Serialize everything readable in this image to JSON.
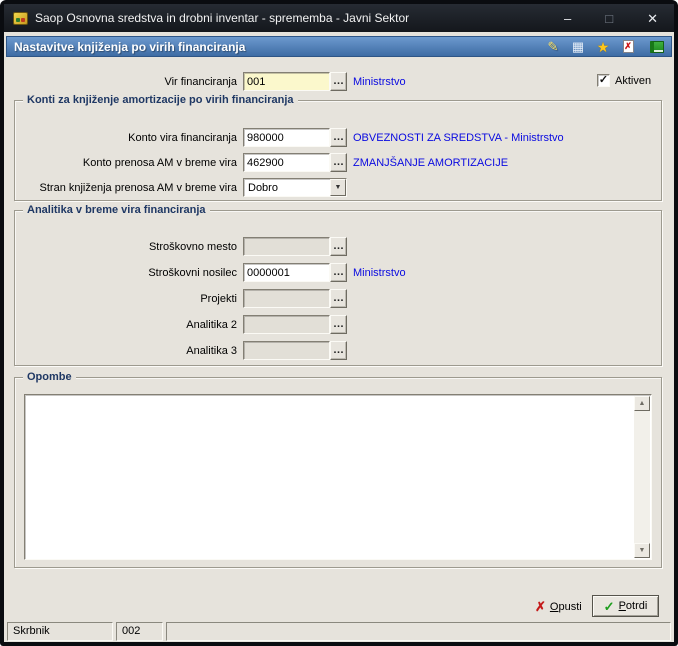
{
  "colors": {
    "window_bg": "#E6E3DC",
    "titlebar_top": "#262B33",
    "titlebar_bottom": "#14171C",
    "header_top": "#6C99CE",
    "header_bottom": "#3E6CA4",
    "accent_blue": "#0A0AE0",
    "field_yellow": "#FBF8CC",
    "group_title": "#1F3864",
    "cancel_red": "#C41A1A",
    "confirm_green": "#1E9E1E"
  },
  "window": {
    "title": "Saop Osnovna sredstva in drobni inventar - sprememba - Javni Sektor"
  },
  "header": {
    "title": "Nastavitve knjiženja po virih financiranja"
  },
  "icons": {
    "minimize": "–",
    "maximize": "□",
    "close": "✕",
    "pencil": "✎",
    "grid": "▦",
    "star": "★",
    "cross": "✗",
    "check": "✓",
    "ellipsis": "…",
    "dropdown_arrow": "▼",
    "scroll_up": "▲",
    "scroll_down": "▼",
    "checkbox_check": "✓"
  },
  "form": {
    "vir": {
      "label": "Vir financiranja",
      "value": "001",
      "desc": "Ministrstvo"
    },
    "aktiven": {
      "label": "Aktiven",
      "checked": true
    }
  },
  "konti": {
    "title": "Konti za knjiženje amortizacije po virih financiranja",
    "konto_vira": {
      "label": "Konto vira financiranja",
      "value": "980000",
      "desc": "OBVEZNOSTI ZA SREDSTVA - Ministrstvo"
    },
    "konto_prenosa": {
      "label": "Konto prenosa AM v breme vira",
      "value": "462900",
      "desc": "ZMANJŠANJE AMORTIZACIJE"
    },
    "stran": {
      "label": "Stran knjiženja prenosa AM v breme vira",
      "value": "Dobro"
    }
  },
  "analitika": {
    "title": "Analitika v breme vira financiranja",
    "rows": [
      {
        "label": "Stroškovno mesto",
        "value": "",
        "desc": "",
        "disabled": true
      },
      {
        "label": "Stroškovni nosilec",
        "value": "0000001",
        "desc": "Ministrstvo",
        "disabled": false
      },
      {
        "label": "Projekti",
        "value": "",
        "desc": "",
        "disabled": true
      },
      {
        "label": "Analitika 2",
        "value": "",
        "desc": "",
        "disabled": true
      },
      {
        "label": "Analitika 3",
        "value": "",
        "desc": "",
        "disabled": true
      }
    ]
  },
  "opombe": {
    "title": "Opombe",
    "value": ""
  },
  "buttons": {
    "opusti": "Opusti",
    "potrdi": "Potrdi"
  },
  "statusbar": {
    "user": "Skrbnik",
    "code": "002",
    "info": ""
  }
}
